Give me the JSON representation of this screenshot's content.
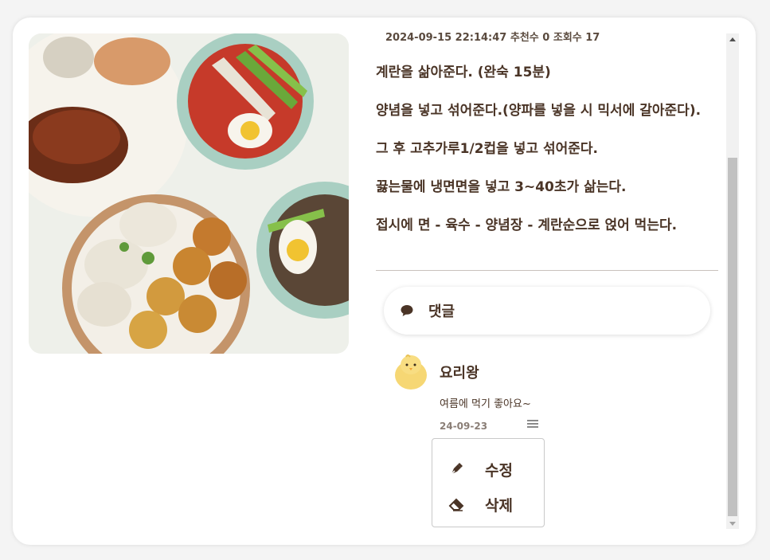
{
  "post": {
    "meta": "2024-09-15 22:14:47 추천수 0 조회수 17",
    "steps": [
      "계란을 삶아준다. (완숙 15분)",
      "양념을 넣고 섞어준다.(양파를 넣을 시 믹서에 갈아준다).",
      "그 후 고추가루1/2컵을 넣고 섞어준다.",
      "끓는물에 냉면면을 넣고 3~40초가 삶는다.",
      "접시에 면 - 육수 - 양념장 - 계란순으로 얹어 먹는다."
    ]
  },
  "comment_box": {
    "icon": "speech-bubble-icon",
    "label": "댓글"
  },
  "comments": [
    {
      "author": "요리왕",
      "text": "여름에 먹기 좋아요~",
      "date": "24-09-23",
      "avatar_icon": "chick-avatar-icon"
    }
  ],
  "comment_menu": {
    "items": [
      {
        "label": "수정",
        "icon": "pen-icon"
      },
      {
        "label": "삭제",
        "icon": "eraser-icon"
      }
    ]
  },
  "colors": {
    "text": "#4a3426",
    "card_bg": "#ffffff",
    "page_bg": "#f4f4f4",
    "scroll_thumb": "#c1c1c1"
  }
}
